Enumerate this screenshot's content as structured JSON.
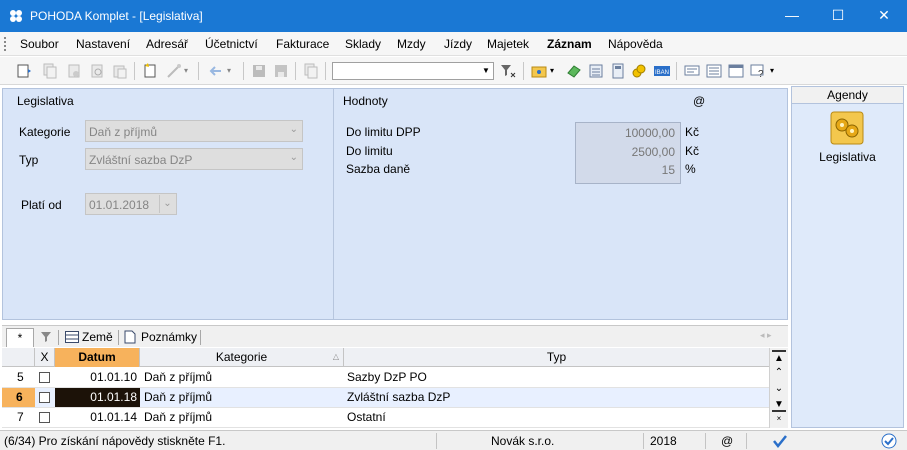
{
  "window": {
    "title": "POHODA Komplet - [Legislativa]",
    "minimize": "—",
    "maximize": "☐",
    "close": "✕"
  },
  "menu": [
    "Soubor",
    "Nastavení",
    "Adresář",
    "Účetnictví",
    "Fakturace",
    "Sklady",
    "Mzdy",
    "Jízdy",
    "Majetek",
    "Záznam",
    "Nápověda"
  ],
  "toolbar": {
    "search_value": "",
    "icons": [
      "attach-icon",
      "copy-icon",
      "cut-icon",
      "print-preview-icon",
      "paste-icon",
      "new-record-icon",
      "wand-icon",
      "back-arrow-icon",
      "save-icon",
      "save-all-icon",
      "document-icon",
      "filter-icon",
      "folder-icon",
      "coins-icon",
      "calculator-icon",
      "calc2-icon",
      "money-icon",
      "iban-icon",
      "message-icon",
      "list-icon",
      "window-icon",
      "help-icon"
    ]
  },
  "left_panel": {
    "title": "Legislativa",
    "kategorie_label": "Kategorie",
    "kategorie_value": "Daň z příjmů",
    "typ_label": "Typ",
    "typ_value": "Zvláštní sazba DzP",
    "plati_label": "Platí od",
    "plati_value": "01.01.2018"
  },
  "right_panel": {
    "title": "Hodnoty",
    "at_symbol": "@",
    "rows": [
      {
        "label": "Do limitu DPP",
        "value": "10000,00",
        "unit": "Kč"
      },
      {
        "label": "Do limitu",
        "value": "2500,00",
        "unit": "Kč"
      },
      {
        "label": "Sazba daně",
        "value": "15",
        "unit": "%"
      }
    ]
  },
  "agendy": {
    "header": "Agendy",
    "item_label": "Legislativa"
  },
  "tabs": {
    "star": "*",
    "zeme": "Země",
    "poznamky": "Poznámky"
  },
  "grid": {
    "headers": {
      "x": "X",
      "datum": "Datum",
      "kategorie": "Kategorie",
      "typ": "Typ"
    },
    "rows": [
      {
        "n": "5",
        "datum": "01.01.10",
        "kategorie": "Daň z příjmů",
        "typ": "Sazby DzP PO",
        "selected": false
      },
      {
        "n": "6",
        "datum": "01.01.18",
        "kategorie": "Daň z příjmů",
        "typ": "Zvláštní sazba DzP",
        "selected": true
      },
      {
        "n": "7",
        "datum": "01.01.14",
        "kategorie": "Daň z příjmů",
        "typ": "Ostatní",
        "selected": false
      }
    ]
  },
  "status": {
    "help": "(6/34) Pro získání nápovědy stiskněte F1.",
    "company": "Novák s.r.o.",
    "year": "2018",
    "at": "@"
  },
  "colors": {
    "titlebar": "#1a78d4",
    "form_bg": "#d9e5f8",
    "datum_header": "#f7b25c",
    "selected_row": "#e8f0ff",
    "selected_rownum": "#f7b25c",
    "selected_cell": "#1c1208"
  }
}
